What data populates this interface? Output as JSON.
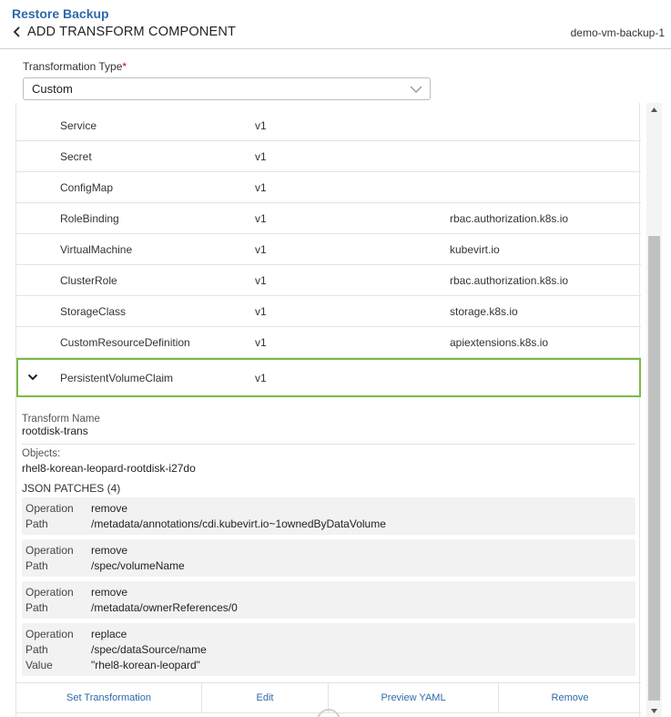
{
  "header": {
    "breadcrumb": "Restore Backup",
    "title": "ADD TRANSFORM COMPONENT",
    "backup_name": "demo-vm-backup-1"
  },
  "form": {
    "type_label": "Transformation Type",
    "required_mark": "*",
    "type_value": "Custom"
  },
  "resources": [
    {
      "kind": "Service",
      "version": "v1",
      "group": ""
    },
    {
      "kind": "Secret",
      "version": "v1",
      "group": ""
    },
    {
      "kind": "ConfigMap",
      "version": "v1",
      "group": ""
    },
    {
      "kind": "RoleBinding",
      "version": "v1",
      "group": "rbac.authorization.k8s.io"
    },
    {
      "kind": "VirtualMachine",
      "version": "v1",
      "group": "kubevirt.io"
    },
    {
      "kind": "ClusterRole",
      "version": "v1",
      "group": "rbac.authorization.k8s.io"
    },
    {
      "kind": "StorageClass",
      "version": "v1",
      "group": "storage.k8s.io"
    },
    {
      "kind": "CustomResourceDefinition",
      "version": "v1",
      "group": "apiextensions.k8s.io"
    }
  ],
  "selected": {
    "kind": "PersistentVolumeClaim",
    "version": "v1"
  },
  "detail": {
    "transform_name_label": "Transform Name",
    "transform_name": "rootdisk-trans",
    "objects_label": "Objects:",
    "objects_value": "rhel8-korean-leopard-rootdisk-i27do",
    "patches_label": "JSON PATCHES (4)",
    "patches": [
      {
        "op_label": "Operation",
        "op": "remove",
        "path_label": "Path",
        "path": "/metadata/annotations/cdi.kubevirt.io~1ownedByDataVolume"
      },
      {
        "op_label": "Operation",
        "op": "remove",
        "path_label": "Path",
        "path": "/spec/volumeName"
      },
      {
        "op_label": "Operation",
        "op": "remove",
        "path_label": "Path",
        "path": "/metadata/ownerReferences/0"
      },
      {
        "op_label": "Operation",
        "op": "replace",
        "path_label": "Path",
        "path": "/spec/dataSource/name",
        "value_label": "Value",
        "value": "\"rhel8-korean-leopard\""
      }
    ]
  },
  "actions": {
    "set": "Set Transformation",
    "edit": "Edit",
    "preview": "Preview YAML",
    "remove": "Remove"
  },
  "icons": {
    "back": "chevron-left-icon",
    "dropdown": "chevron-down-icon",
    "expand": "chevron-down-icon",
    "loading": "spinner-icon"
  },
  "colors": {
    "link": "#2e6aa8",
    "selected_border": "#7cba4a",
    "required": "#d0021b"
  }
}
